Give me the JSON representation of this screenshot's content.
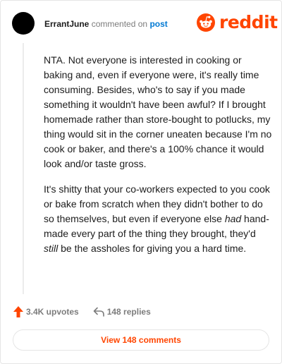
{
  "header": {
    "username": "ErrantJune",
    "commented_text": "commented on",
    "post_link": "post"
  },
  "logo": {
    "wordmark": "reddit",
    "icon": "reddit-snoo-icon",
    "color": "#ff4500"
  },
  "comment": {
    "paragraphs": [
      [
        {
          "text": "NTA. Not everyone is interested in cooking or baking and, even if everyone were, it's really time consuming. Besides, who's to say if you made something it wouldn't have been awful? If I brought homemade rather than store-bought to potlucks, my thing would sit in the corner uneaten because I'm no cook or baker, and there's a 100% chance it would look and/or taste gross."
        }
      ],
      [
        {
          "text": "It's shitty that your co-workers expected to you cook or bake from scratch when they didn't bother to do so themselves, but even if everyone else "
        },
        {
          "text": "had",
          "italic": true
        },
        {
          "text": " hand-made every part of the thing they brought, they'd "
        },
        {
          "text": "still",
          "italic": true
        },
        {
          "text": " be the assholes for giving you a hard time."
        }
      ]
    ]
  },
  "footer": {
    "upvotes": "3.4K upvotes",
    "upvote_icon": "upvote-arrow-icon",
    "replies": "148 replies",
    "reply_icon": "reply-arrow-icon",
    "upvote_color": "#ff4500"
  },
  "view_button": {
    "label": "View 148 comments"
  }
}
